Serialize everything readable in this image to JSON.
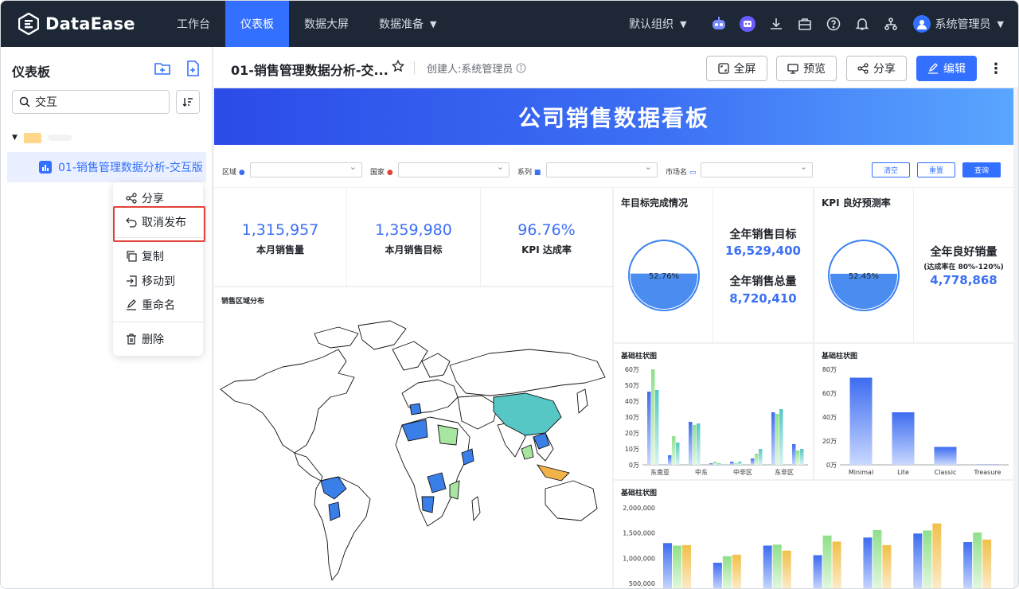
{
  "app": {
    "name": "DataEase"
  },
  "nav": {
    "items": [
      {
        "label": "工作台",
        "active": false
      },
      {
        "label": "仪表板",
        "active": true
      },
      {
        "label": "数据大屏",
        "active": false
      },
      {
        "label": "数据准备",
        "active": false,
        "dropdown": true
      }
    ],
    "org": "默认组织",
    "user": "系统管理员"
  },
  "sidebar": {
    "title": "仪表板",
    "search_value": "交互",
    "tree_item": "01-销售管理数据分析-交互版",
    "context_menu": [
      "分享",
      "取消发布",
      "复制",
      "移动到",
      "重命名",
      "删除"
    ]
  },
  "header": {
    "title": "01-销售管理数据分析-交...",
    "creator": "创建人:系统管理员",
    "buttons": {
      "fullscreen": "全屏",
      "preview": "预览",
      "share": "分享",
      "edit": "编辑"
    }
  },
  "dashboard": {
    "banner": "公司销售数据看板",
    "filters": [
      {
        "label": "区域"
      },
      {
        "label": "国家"
      },
      {
        "label": "系列"
      },
      {
        "label": "市场名"
      }
    ],
    "filter_buttons": {
      "clear": "清空",
      "reset": "重置",
      "query": "查询"
    },
    "kpis": [
      {
        "value": "1,315,957",
        "label": "本月销售量"
      },
      {
        "value": "1,359,980",
        "label": "本月销售目标"
      },
      {
        "value": "96.76%",
        "label": "KPI 达成率"
      }
    ],
    "gauge1": {
      "title": "年目标完成情况",
      "value": "52.76%",
      "fill": 0.5276,
      "side": [
        {
          "label": "全年销售目标",
          "value": "16,529,400"
        },
        {
          "label": "全年销售总量",
          "value": "8,720,410"
        }
      ]
    },
    "gauge2": {
      "title": "KPI 良好预测率",
      "value": "52.45%",
      "fill": 0.5245,
      "side_label": "全年良好销量",
      "side_sub": "(达成率在 80%-120%)",
      "side_value": "4,778,868"
    },
    "map": {
      "title": "销售区域分布"
    },
    "colors": {
      "primary": "#3370ff",
      "nav": "#1d2736",
      "accent_red": "#e0443b",
      "map_teal": "#56c7c5",
      "map_blue": "#3a7ee8",
      "map_green": "#a8e5a0",
      "map_orange": "#f2b24a"
    }
  },
  "chart_data": [
    {
      "type": "bar",
      "title": "基础柱状图",
      "categories": [
        "东南亚",
        "中东",
        "中非区",
        "东非区"
      ],
      "ylim": [
        0,
        60
      ],
      "ytick_labels": [
        "0万",
        "10万",
        "20万",
        "30万",
        "40万",
        "50万",
        "60万"
      ],
      "series": [
        {
          "values": [
            46,
            27,
            2,
            33
          ]
        },
        {
          "values": [
            60,
            25,
            1,
            32
          ]
        },
        {
          "values": [
            47,
            26,
            2,
            35
          ]
        },
        {
          "values": [
            6,
            1,
            4,
            13
          ]
        },
        {
          "values": [
            18,
            2,
            7,
            9
          ]
        },
        {
          "values": [
            14,
            1,
            10,
            10
          ]
        }
      ],
      "grouping": "two clusters per category"
    },
    {
      "type": "bar",
      "title": "基础柱状图",
      "categories": [
        "Minimal",
        "Lite",
        "Classic",
        "Treasure"
      ],
      "ylim": [
        0,
        80
      ],
      "ytick_labels": [
        "0万",
        "20万",
        "40万",
        "60万",
        "80万"
      ],
      "values": [
        73,
        44,
        15,
        0.2
      ]
    },
    {
      "type": "bar",
      "title": "基础柱状图",
      "ytick_labels": [
        "500,000",
        "1,000,000",
        "1,500,000",
        "2,000,000"
      ],
      "ylim_visible": [
        400000,
        2000000
      ],
      "groups": [
        [
          1300000,
          1250000,
          1260000
        ],
        [
          910000,
          1040000,
          1070000
        ],
        [
          1250000,
          1270000,
          1150000
        ],
        [
          1060000,
          1450000,
          1330000
        ],
        [
          1410000,
          1560000,
          1260000
        ],
        [
          1490000,
          1550000,
          1690000
        ],
        [
          1320000,
          1510000,
          1370000
        ]
      ]
    }
  ]
}
